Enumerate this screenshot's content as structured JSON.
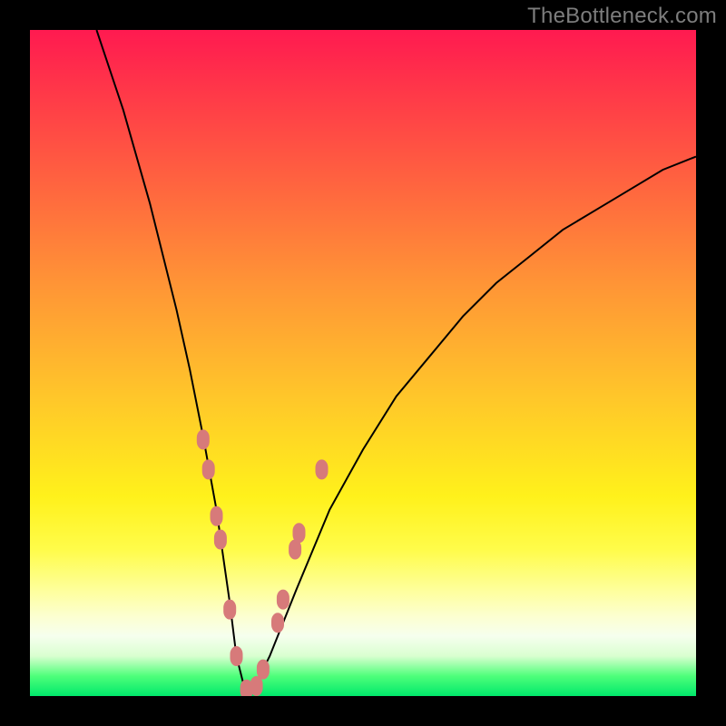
{
  "watermark": "TheBottleneck.com",
  "chart_data": {
    "type": "line",
    "title": "",
    "xlabel": "",
    "ylabel": "",
    "xlim": [
      0,
      100
    ],
    "ylim": [
      0,
      100
    ],
    "background_gradient_meaning": "vertical heat map: top=red (bad/bottleneck), bottom=green (optimal)",
    "series": [
      {
        "name": "bottleneck-curve",
        "stroke": "#000000",
        "x": [
          10,
          14,
          18,
          22,
          24,
          26,
          28,
          30,
          31,
          32,
          33,
          34,
          36,
          40,
          45,
          50,
          55,
          60,
          65,
          70,
          75,
          80,
          85,
          90,
          95,
          100
        ],
        "values": [
          100,
          88,
          74,
          58,
          49,
          39,
          28,
          14,
          6,
          2,
          1,
          2,
          6,
          16,
          28,
          37,
          45,
          51,
          57,
          62,
          66,
          70,
          73,
          76,
          79,
          81
        ]
      },
      {
        "name": "data-points",
        "stroke": "#d77a7a",
        "fill": "#d77a7a",
        "marker": "rounded-rect",
        "x": [
          26.0,
          26.8,
          28.0,
          28.6,
          30.0,
          31.0,
          32.5,
          34.0,
          35.0,
          37.2,
          38.0,
          39.8,
          40.4,
          43.8
        ],
        "values": [
          38.5,
          34.0,
          27.0,
          23.5,
          13.0,
          6.0,
          1.0,
          1.5,
          4.0,
          11.0,
          14.5,
          22.0,
          24.5,
          34.0
        ]
      }
    ]
  }
}
